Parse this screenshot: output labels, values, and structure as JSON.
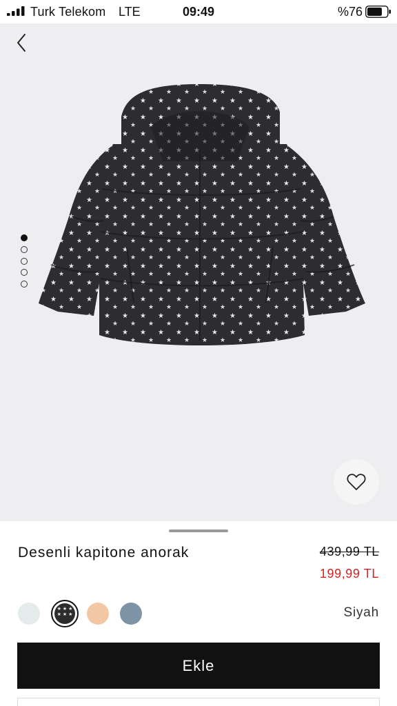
{
  "status_bar": {
    "carrier": "Turk Telekom",
    "network": "LTE",
    "time": "09:49",
    "battery_percent": "%76",
    "battery_level": 0.76
  },
  "gallery": {
    "image_count": 5,
    "active_index": 0
  },
  "product": {
    "name": "Desenli kapitone anorak",
    "price_original": "439,99 TL",
    "price_sale": "199,99 TL",
    "selected_color_name": "Siyah",
    "sale_color": "#d42020"
  },
  "swatches": [
    {
      "color": "#e3eceb",
      "selected": false
    },
    {
      "color": "#2c2c2e",
      "selected": true,
      "pattern": "stars"
    },
    {
      "color": "#f2c8a4",
      "selected": false
    },
    {
      "color": "#7f93a6",
      "selected": false
    }
  ],
  "actions": {
    "add_label": "Ekle"
  },
  "icons": {
    "back": "chevron-left-icon",
    "wishlist": "heart-icon"
  }
}
